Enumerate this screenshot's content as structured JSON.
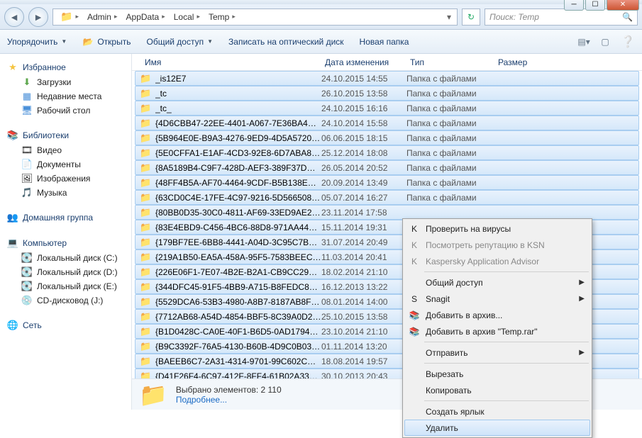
{
  "window": {
    "breadcrumb": [
      "Admin",
      "AppData",
      "Local",
      "Temp"
    ],
    "search_placeholder": "Поиск: Temp"
  },
  "toolbar": {
    "organize": "Упорядочить",
    "open": "Открыть",
    "share": "Общий доступ",
    "burn": "Записать на оптический диск",
    "newfolder": "Новая папка"
  },
  "sidebar": {
    "favorites": {
      "label": "Избранное",
      "items": [
        "Загрузки",
        "Недавние места",
        "Рабочий стол"
      ]
    },
    "libraries": {
      "label": "Библиотеки",
      "items": [
        "Видео",
        "Документы",
        "Изображения",
        "Музыка"
      ]
    },
    "homegroup": {
      "label": "Домашняя группа"
    },
    "computer": {
      "label": "Компьютер",
      "items": [
        "Локальный диск (C:)",
        "Локальный диск (D:)",
        "Локальный диск (E:)",
        "CD-дисковод (J:)"
      ]
    },
    "network": {
      "label": "Сеть"
    }
  },
  "columns": {
    "name": "Имя",
    "date": "Дата изменения",
    "type": "Тип",
    "size": "Размер"
  },
  "foldertype": "Папка с файлами",
  "files": [
    {
      "n": "_is12E7",
      "d": "24.10.2015 14:55",
      "sel": true
    },
    {
      "n": "_tc",
      "d": "26.10.2015 13:58",
      "sel": true
    },
    {
      "n": "_tc_",
      "d": "24.10.2015 16:16",
      "sel": true
    },
    {
      "n": "{4D6CBB47-22EE-4401-A067-7E36BA4F37...",
      "d": "24.10.2014 15:58",
      "sel": true
    },
    {
      "n": "{5B964E0E-B9A3-4276-9ED9-4D5A572074...",
      "d": "06.06.2015 18:15",
      "sel": true
    },
    {
      "n": "{5E0CFFA1-E1AF-4CD3-92E8-6D7ABA881...",
      "d": "25.12.2014 18:08",
      "sel": true
    },
    {
      "n": "{8A5189B4-C9F7-428D-AEF3-389F37DC34...",
      "d": "26.05.2014 20:52",
      "sel": true
    },
    {
      "n": "{48FF4B5A-AF70-4464-9CDF-B5B138EB5B...",
      "d": "20.09.2014 13:49",
      "sel": true
    },
    {
      "n": "{63CD0C4E-17FE-4C97-9216-5D56650887...",
      "d": "05.07.2014 16:27",
      "sel": true
    },
    {
      "n": "{80BB0D35-30C0-4811-AF69-33ED9AE27...",
      "d": "23.11.2014 17:58",
      "sel": true
    },
    {
      "n": "{83E4EBD9-C456-4BC6-88D8-971AA44CC2...",
      "d": "15.11.2014 19:31",
      "sel": true
    },
    {
      "n": "{179BF7EE-6BB8-4441-A04D-3C95C7B5F0...",
      "d": "31.07.2014 20:49",
      "sel": true
    },
    {
      "n": "{219A1B50-EA5A-458A-95F5-7583BEECC...",
      "d": "11.03.2014 20:41",
      "sel": true
    },
    {
      "n": "{226E06F1-7E07-4B2E-B2A1-CB9CC29754...",
      "d": "18.02.2014 21:10",
      "sel": true
    },
    {
      "n": "{344DFC45-91F5-4BB9-A715-B8FEDC84C232}",
      "d": "16.12.2013 13:22",
      "sel": true
    },
    {
      "n": "{5529DCA6-53B3-4980-A8B7-8187AB8F06E...",
      "d": "08.01.2014 14:00",
      "sel": true
    },
    {
      "n": "{7712AB68-A54D-4854-BBF5-8C39A0D23EC5}",
      "d": "25.10.2015 13:58",
      "sel": true
    },
    {
      "n": "{B1D0428C-CA0E-40F1-B6D5-0AD17943E...",
      "d": "23.10.2014 21:10",
      "sel": true
    },
    {
      "n": "{B9C3392F-76A5-4130-B60B-4D9C0B03E6...",
      "d": "01.11.2014 13:20",
      "sel": true
    },
    {
      "n": "{BAEEB6C7-2A31-4314-9701-99C602CB3E...",
      "d": "18.08.2014 19:57",
      "sel": true
    },
    {
      "n": "{D41F26F4-6C97-412F-8FF4-61B02A337D...",
      "d": "30.10.2013 20:43",
      "sel": true
    }
  ],
  "status": {
    "selected": "Выбрано элементов: 2 110",
    "more": "Подробнее..."
  },
  "contextmenu": {
    "items": [
      {
        "label": "Проверить на вирусы",
        "icon": "K",
        "cls": ""
      },
      {
        "label": "Посмотреть репутацию в KSN",
        "icon": "K",
        "cls": "disabled"
      },
      {
        "label": "Kaspersky Application Advisor",
        "icon": "K",
        "cls": "disabled"
      },
      {
        "sep": true
      },
      {
        "label": "Общий доступ",
        "arrow": true
      },
      {
        "label": "Snagit",
        "icon": "S",
        "arrow": true
      },
      {
        "label": "Добавить в архив...",
        "icon": "📚"
      },
      {
        "label": "Добавить в архив \"Temp.rar\"",
        "icon": "📚"
      },
      {
        "sep": true
      },
      {
        "label": "Отправить",
        "arrow": true
      },
      {
        "sep": true
      },
      {
        "label": "Вырезать"
      },
      {
        "label": "Копировать"
      },
      {
        "sep": true
      },
      {
        "label": "Создать ярлык"
      },
      {
        "label": "Удалить",
        "hover": true
      }
    ]
  }
}
